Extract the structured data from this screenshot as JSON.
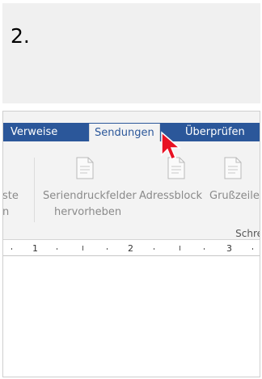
{
  "step": {
    "number": "2."
  },
  "tabs": [
    {
      "label": "Verweise"
    },
    {
      "label": "Sendungen"
    },
    {
      "label": "Überprüfen"
    }
  ],
  "ribbon": {
    "partial_left": {
      "line1": "ste",
      "line2": "n"
    },
    "buttons": [
      {
        "label_line1": "Seriendruckfelder",
        "label_line2": "hervorheben",
        "icon": "document-icon"
      },
      {
        "label_line1": "Adressblock",
        "icon": "document-icon"
      },
      {
        "label_line1": "Grußzeile",
        "icon": "document-icon"
      }
    ],
    "group_label": "Schre"
  },
  "ruler": {
    "labels": [
      "1",
      "2",
      "3"
    ]
  },
  "colors": {
    "tab_strip": "#2b579a",
    "ribbon_bg": "#f3f3f3",
    "cursor": "#e81123"
  }
}
